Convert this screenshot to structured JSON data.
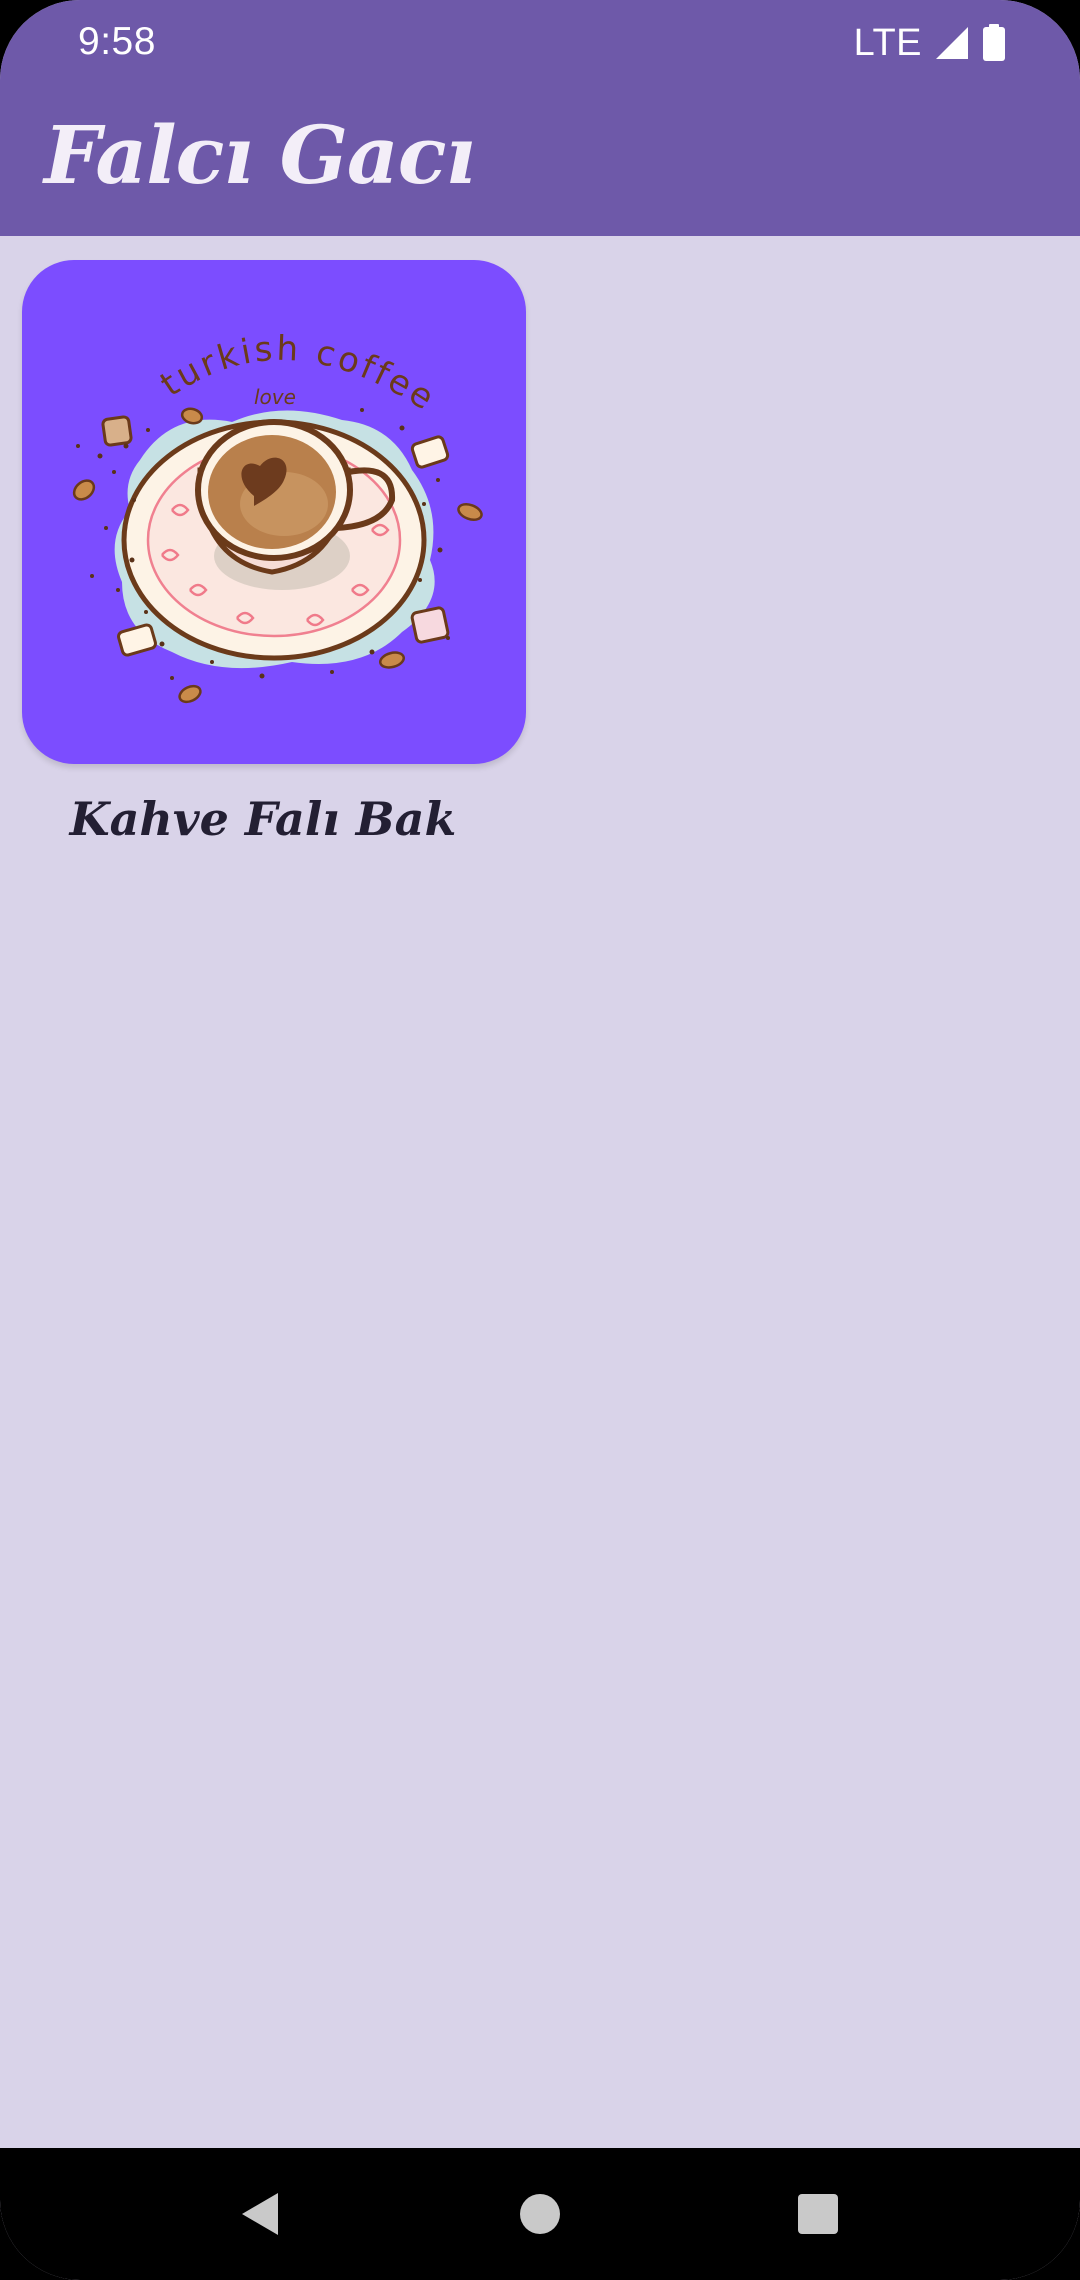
{
  "status_bar": {
    "time": "9:58",
    "network": "LTE",
    "icons": [
      "signal-icon",
      "battery-icon"
    ]
  },
  "app_bar": {
    "title": "Falcı Gacı",
    "background_color": "#6e59a9"
  },
  "main": {
    "background_color": "#d9d3e9",
    "tiles": [
      {
        "label": "Kahve Falı Bak",
        "image_caption": "turkish coffee",
        "image_subcaption": "love",
        "tile_color": "#7c4dff"
      }
    ]
  },
  "nav_bar": {
    "buttons": [
      "back-icon",
      "home-icon",
      "recents-icon"
    ]
  }
}
